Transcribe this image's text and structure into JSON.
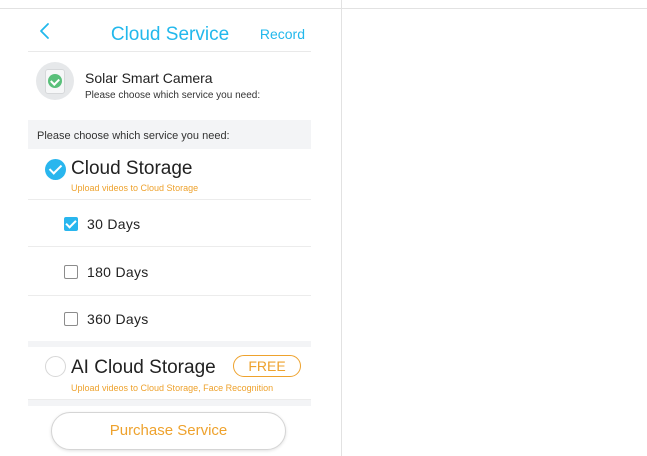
{
  "header": {
    "title": "Cloud Service",
    "record_label": "Record"
  },
  "device": {
    "name": "Solar Smart Camera",
    "subtitle": "Please choose which service you need:"
  },
  "section_label": "Please choose which service you need:",
  "plans": [
    {
      "name": "Cloud Storage",
      "description": "Upload videos to Cloud Storage",
      "selected": true,
      "options": [
        {
          "label": "30 Days",
          "checked": true
        },
        {
          "label": "180 Days",
          "checked": false
        },
        {
          "label": "360 Days",
          "checked": false
        }
      ]
    },
    {
      "name": "AI Cloud Storage",
      "description": "Upload videos to Cloud Storage, Face Recognition",
      "badge": "FREE",
      "selected": false
    }
  ],
  "purchase_label": "Purchase Service",
  "colors": {
    "accent": "#29b6ee",
    "orange": "#eea22d",
    "band": "#f3f4f6"
  },
  "icons": {
    "back": "chevron-left-icon",
    "device": "camera-icon",
    "check": "check-icon"
  }
}
